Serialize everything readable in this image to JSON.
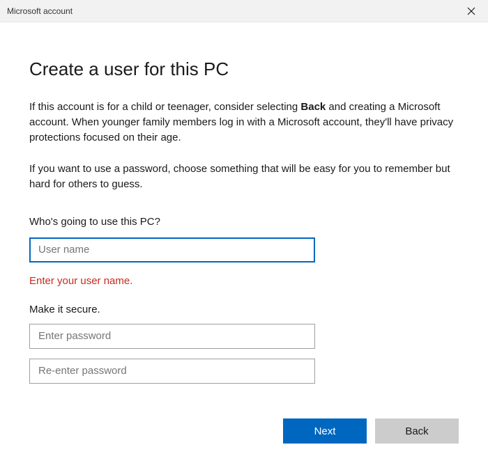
{
  "window": {
    "title": "Microsoft account"
  },
  "heading": "Create a user for this PC",
  "intro": {
    "pre": "If this account is for a child or teenager, consider selecting ",
    "bold": "Back",
    "post": " and creating a Microsoft account. When younger family members log in with a Microsoft account, they'll have privacy protections focused on their age."
  },
  "password_hint": "If you want to use a password, choose something that will be easy for you to remember but hard for others to guess.",
  "section_user": {
    "label": "Who's going to use this PC?",
    "placeholder": "User name",
    "error": "Enter your user name."
  },
  "section_secure": {
    "label": "Make it secure.",
    "password_placeholder": "Enter password",
    "reenter_placeholder": "Re-enter password"
  },
  "buttons": {
    "next": "Next",
    "back": "Back"
  }
}
